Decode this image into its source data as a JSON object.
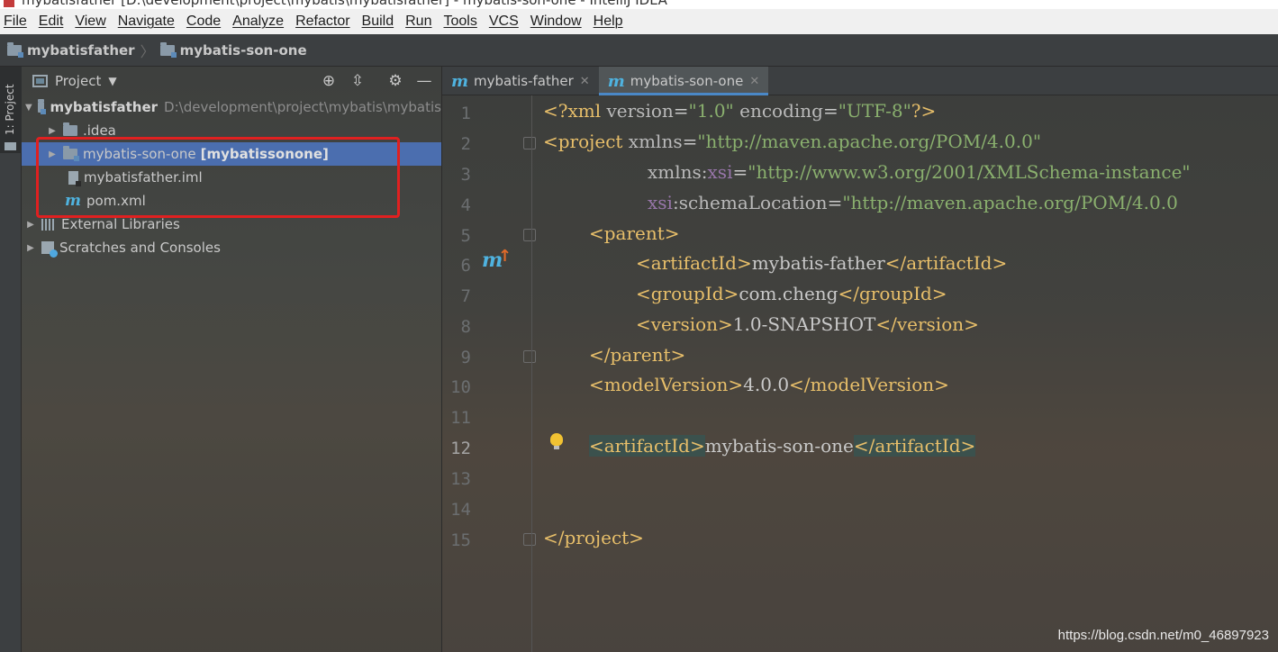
{
  "window": {
    "title": "mybatisfather [D:\\development\\project\\mybatis\\mybatisfather] - mybatis-son-one - IntelliJ IDEA"
  },
  "menu": [
    "File",
    "Edit",
    "View",
    "Navigate",
    "Code",
    "Analyze",
    "Refactor",
    "Build",
    "Run",
    "Tools",
    "VCS",
    "Window",
    "Help"
  ],
  "breadcrumb": [
    "mybatisfather",
    "mybatis-son-one"
  ],
  "tool_strip": {
    "label": "1: Project"
  },
  "project_panel": {
    "title": "Project",
    "root": {
      "name": "mybatisfather",
      "path": "D:\\development\\project\\mybatis\\mybatis"
    },
    "items": [
      {
        "label": ".idea"
      },
      {
        "label": "mybatis-son-one",
        "module_tag": "[mybatissonone]"
      },
      {
        "label": "mybatisfather.iml"
      },
      {
        "label": "pom.xml"
      },
      {
        "label": "External Libraries"
      },
      {
        "label": "Scratches and Consoles"
      }
    ]
  },
  "editor": {
    "tabs": [
      {
        "label": "mybatis-father",
        "active": false
      },
      {
        "label": "mybatis-son-one",
        "active": true
      }
    ],
    "current_line": 12,
    "line_numbers": [
      "1",
      "2",
      "3",
      "4",
      "5",
      "6",
      "7",
      "8",
      "9",
      "10",
      "11",
      "12",
      "13",
      "14",
      "15"
    ],
    "code": {
      "l1": {
        "a": "<?xml ",
        "b": "version",
        "c": "=",
        "d": "\"1.0\"",
        "e": " encoding",
        "f": "=",
        "g": "\"UTF-8\"",
        "h": "?>"
      },
      "l2": {
        "a": "<project ",
        "b": "xmlns",
        "c": "=",
        "d": "\"http://maven.apache.org/POM/4.0.0\""
      },
      "l3": {
        "a": "xmlns:",
        "b": "xsi",
        "c": "=",
        "d": "\"http://www.w3.org/2001/XMLSchema-instance\""
      },
      "l4": {
        "a": "xsi",
        "b": ":schemaLocation",
        "c": "=",
        "d": "\"http://maven.apache.org/POM/4.0.0"
      },
      "l5": {
        "a": "<parent>"
      },
      "l6": {
        "a": "<artifactId>",
        "b": "mybatis-father",
        "c": "</artifactId>"
      },
      "l7": {
        "a": "<groupId>",
        "b": "com.cheng",
        "c": "</groupId>"
      },
      "l8": {
        "a": "<version>",
        "b": "1.0-SNAPSHOT",
        "c": "</version>"
      },
      "l9": {
        "a": "</parent>"
      },
      "l10": {
        "a": "<modelVersion>",
        "b": "4.0.0",
        "c": "</modelVersion>"
      },
      "l12": {
        "a": "<artifactId>",
        "b": "mybatis-son-one",
        "c": "</artifactId>"
      },
      "l15": {
        "a": "</project>"
      }
    }
  },
  "watermark": "https://blog.csdn.net/m0_46897923",
  "colors": {
    "selection": "#4b6eaf",
    "annotation_box": "#e02020",
    "tag": "#e8bf6a",
    "string": "#8ab06e",
    "maven_icon": "#4fb3e0"
  }
}
